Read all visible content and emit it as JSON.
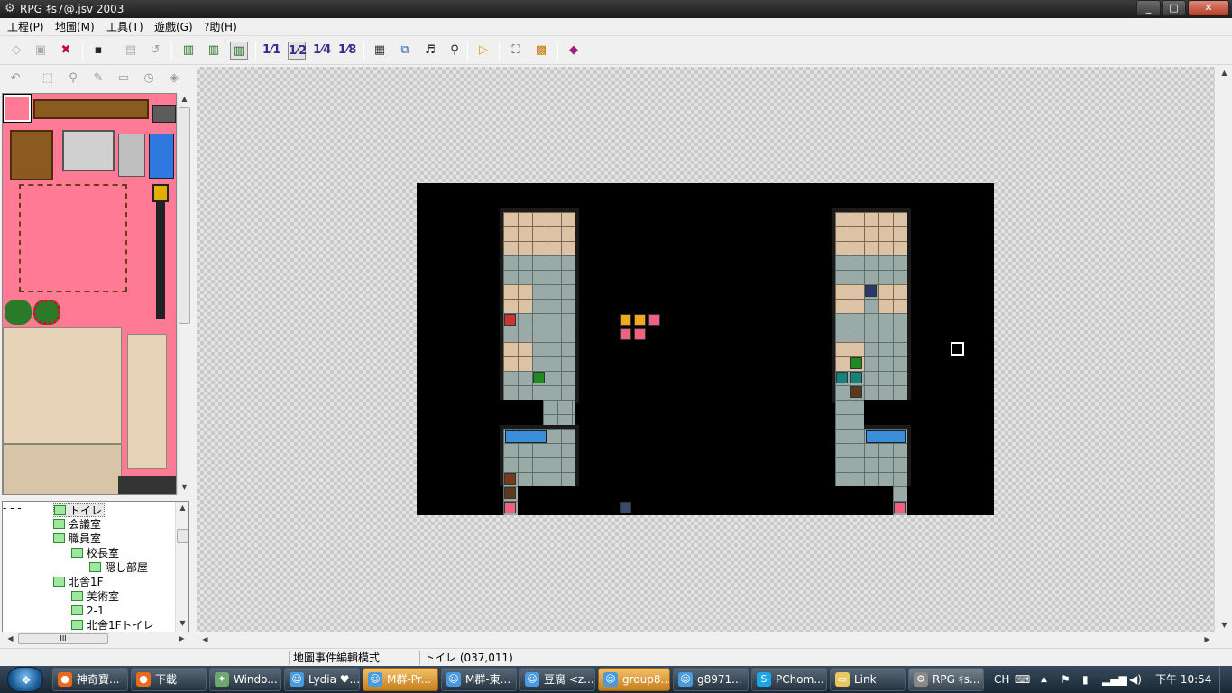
{
  "window": {
    "title": "RPG ｷs7@.jsv 2003",
    "min": "_",
    "max": "□",
    "close": "✕"
  },
  "menu": [
    "工程(P)",
    "地圖(M)",
    "工具(T)",
    "遊戲(G)",
    "?助(H)"
  ],
  "toolbar": {
    "scale_labels": [
      "1⁄1",
      "1⁄2",
      "1⁄4",
      "1⁄8"
    ],
    "active_scale": "1⁄2"
  },
  "tree": {
    "nodes": [
      {
        "label": "トイレ",
        "level": 2,
        "selected": true
      },
      {
        "label": "会議室",
        "level": 2
      },
      {
        "label": "職員室",
        "level": 2,
        "expander": "⊟"
      },
      {
        "label": "校長室",
        "level": 3,
        "expander": "⊟"
      },
      {
        "label": "隠し部屋",
        "level": 4
      },
      {
        "label": "北舎1F",
        "level": 2,
        "expander": "⊟"
      },
      {
        "label": "美術室",
        "level": 3
      },
      {
        "label": "2-1",
        "level": 3
      },
      {
        "label": "北舎1Fトイレ",
        "level": 3
      }
    ],
    "hscroll_label": "III"
  },
  "status": {
    "mode": "地圖事件編輯模式",
    "location": "トイレ (037,011)"
  },
  "taskbar": {
    "items": [
      {
        "label": "神奇寶...",
        "icon": "firefox-icon"
      },
      {
        "label": "下載",
        "icon": "firefox-icon"
      },
      {
        "label": "Windo...",
        "icon": "windows-live-icon"
      },
      {
        "label": "Lydia ♥...",
        "icon": "messenger-icon"
      },
      {
        "label": "M群-Pr...",
        "icon": "messenger-icon"
      },
      {
        "label": "M群-東...",
        "icon": "messenger-icon"
      },
      {
        "label": "豆腐 <z...",
        "icon": "messenger-icon"
      },
      {
        "label": "group8...",
        "icon": "messenger-icon"
      },
      {
        "label": "g8971...",
        "icon": "messenger-icon"
      },
      {
        "label": "PChom...",
        "icon": "skype-icon"
      },
      {
        "label": "Link",
        "icon": "folder-icon"
      },
      {
        "label": "RPG ｷs...",
        "icon": "rpg-maker-icon"
      }
    ],
    "lang": "CH",
    "clock": "下午 10:54"
  },
  "colors": {
    "event_pink": "#f0607f",
    "event_orange": "#f2a81d",
    "event_green": "#1f8a1f",
    "event_teal": "#15837a"
  }
}
